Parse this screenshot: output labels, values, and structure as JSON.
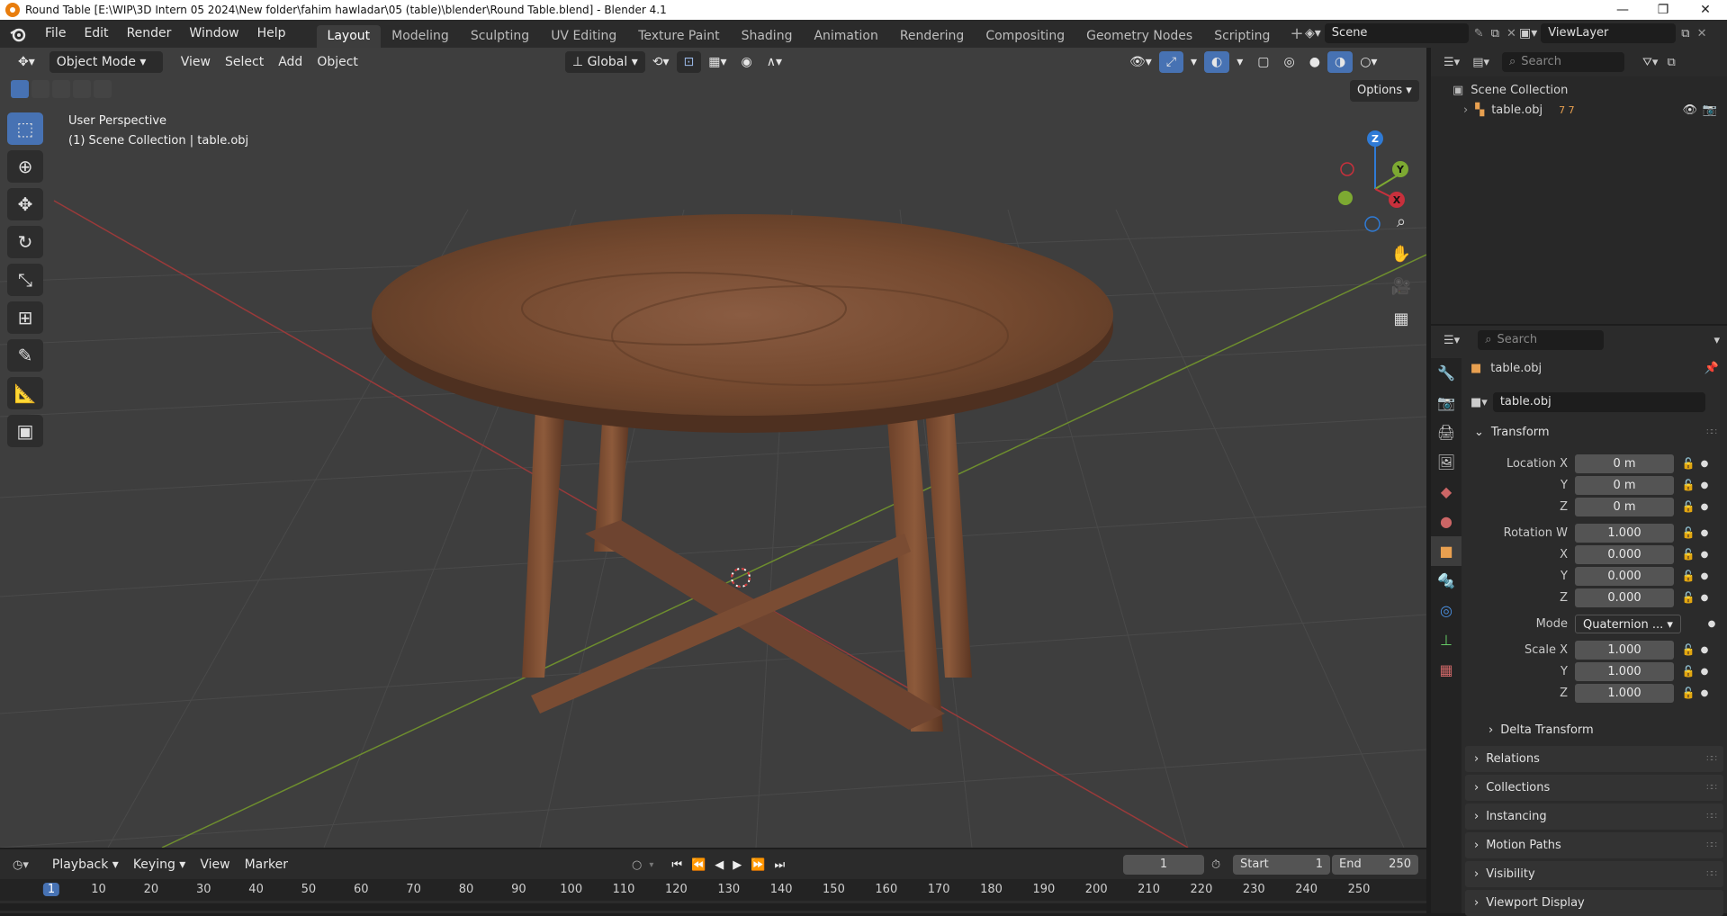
{
  "window": {
    "title": "Round Table [E:\\WIP\\3D Intern 05 2024\\New folder\\fahim hawladar\\05 (table)\\blender\\Round Table.blend] - Blender 4.1",
    "minimize": "—",
    "restore": "❐",
    "close": "✕"
  },
  "menus": [
    "File",
    "Edit",
    "Render",
    "Window",
    "Help"
  ],
  "workspaces": [
    "Layout",
    "Modeling",
    "Sculpting",
    "UV Editing",
    "Texture Paint",
    "Shading",
    "Animation",
    "Rendering",
    "Compositing",
    "Geometry Nodes",
    "Scripting"
  ],
  "active_workspace": "Layout",
  "scene": "Scene",
  "view_layer": "ViewLayer",
  "viewport": {
    "mode": "Object Mode",
    "menus": [
      "View",
      "Select",
      "Add",
      "Object"
    ],
    "orientation": "Global",
    "options": "Options",
    "overlay_line1": "User Perspective",
    "overlay_line2": "(1) Scene Collection | table.obj",
    "gizmo": {
      "z": "Z",
      "y": "Y",
      "x": "X"
    }
  },
  "outliner": {
    "search_placeholder": "Search",
    "collection": "Scene Collection",
    "item": "table.obj",
    "item_counts": "7 7"
  },
  "properties": {
    "search_placeholder": "Search",
    "object_name": "table.obj",
    "object_field": "table.obj",
    "transform_title": "Transform",
    "location": {
      "label_x": "Location X",
      "x": "0 m",
      "y": "0 m",
      "z": "0 m"
    },
    "rotation": {
      "label_w": "Rotation W",
      "w": "1.000",
      "x": "0.000",
      "y": "0.000",
      "z": "0.000"
    },
    "mode_label": "Mode",
    "mode_value": "Quaternion ...",
    "scale": {
      "label_x": "Scale X",
      "x": "1.000",
      "y": "1.000",
      "z": "1.000"
    },
    "axis_y": "Y",
    "axis_z": "Z",
    "axis_x": "X",
    "delta_transform": "Delta Transform",
    "panels": [
      "Relations",
      "Collections",
      "Instancing",
      "Motion Paths",
      "Visibility",
      "Viewport Display"
    ]
  },
  "timeline": {
    "menus": [
      "Playback",
      "Keying",
      "View",
      "Marker"
    ],
    "current_frame": "1",
    "start_label": "Start",
    "start": "1",
    "end_label": "End",
    "end": "250",
    "ticks": [
      "1",
      "10",
      "20",
      "30",
      "40",
      "50",
      "60",
      "70",
      "80",
      "90",
      "100",
      "110",
      "120",
      "130",
      "140",
      "150",
      "160",
      "170",
      "180",
      "190",
      "200",
      "210",
      "220",
      "230",
      "240",
      "250"
    ]
  },
  "colors": {
    "accent": "#4772b3",
    "x_axis": "#c8303c",
    "y_axis": "#7da932",
    "z_axis": "#2f7bd6",
    "wood": "#7a4e35"
  }
}
